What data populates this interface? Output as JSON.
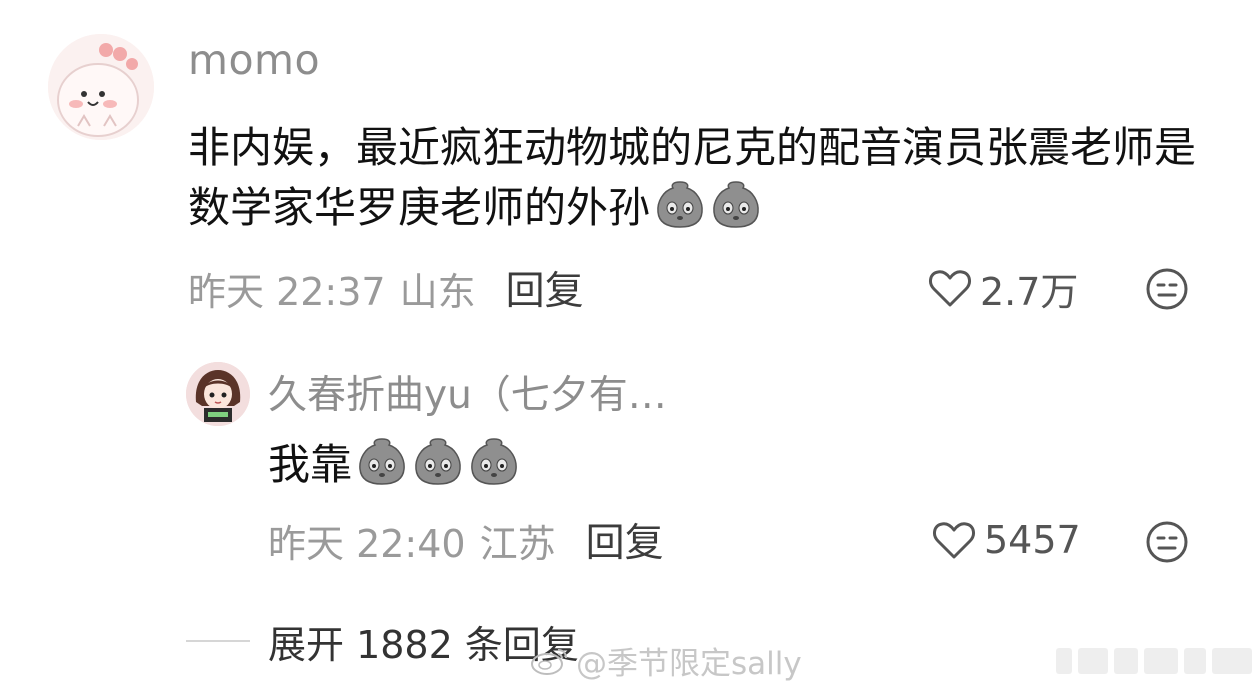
{
  "main_comment": {
    "username": "momo",
    "avatar_icon": "pink-dinosaur-avatar-icon",
    "text": "非内娱，最近疯狂动物城的尼克的配音演员张震老师是数学家华罗庚老师的外孙",
    "emoji_icon": "stone-face-emoji-icon",
    "emoji_count": 2,
    "time": "昨天 22:37",
    "location": "山东",
    "reply_label": "回复",
    "likes": "2.7万",
    "more_icon": "meh-face-icon"
  },
  "sub_reply": {
    "username": "久春折曲yu（七夕有…",
    "avatar_icon": "anime-girl-avatar-icon",
    "text": "我靠",
    "emoji_icon": "stone-face-emoji-icon",
    "emoji_count": 3,
    "time": "昨天 22:40",
    "location": "江苏",
    "reply_label": "回复",
    "likes": "5457",
    "more_icon": "meh-face-icon"
  },
  "expand": {
    "label": "展开 1882 条回复"
  },
  "watermark": {
    "text": "@季节限定sally",
    "icon": "weibo-logo-icon"
  },
  "colors": {
    "username": "#8d8d8d",
    "body_text": "#111111",
    "meta_text": "#9a9a9a",
    "reply_text": "#3c3c3c",
    "like_text": "#555555"
  }
}
